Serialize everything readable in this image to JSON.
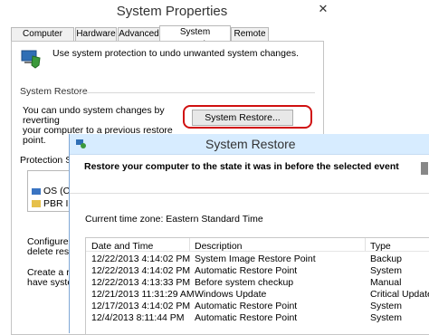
{
  "system_properties": {
    "title": "System Properties",
    "close_glyph": "✕",
    "tabs": [
      "Computer Name",
      "Hardware",
      "Advanced",
      "System Protection",
      "Remote"
    ],
    "active_tab": "System Protection",
    "intro": "Use system protection to undo unwanted system changes.",
    "system_restore_group": "System Restore",
    "system_restore_desc_1": "You can undo system changes by reverting",
    "system_restore_desc_2": "your computer to a previous restore point.",
    "system_restore_button": "System Restore...",
    "protection_settings_label": "Protection Se",
    "drives": [
      "OS (C:",
      "PBR Im"
    ],
    "configure_1": "Configure re",
    "configure_2": "delete restore",
    "create_1": "Create a re",
    "create_2": "have syste"
  },
  "system_restore": {
    "title": "System Restore",
    "header": "Restore your computer to the state it was in before the selected event",
    "timezone": "Current time zone: Eastern Standard Time",
    "columns": [
      "Date and Time",
      "Description",
      "Type"
    ],
    "rows": [
      {
        "date": "12/22/2013 4:14:02 PM",
        "description": "System Image Restore Point",
        "type": "Backup"
      },
      {
        "date": "12/22/2013 4:14:02 PM",
        "description": "Automatic Restore Point",
        "type": "System"
      },
      {
        "date": "12/22/2013 4:13:33 PM",
        "description": "Before system checkup",
        "type": "Manual"
      },
      {
        "date": "12/21/2013 11:31:29 AM",
        "description": "Windows Update",
        "type": "Critical Update"
      },
      {
        "date": "12/17/2013 4:14:02 PM",
        "description": "Automatic Restore Point",
        "type": "System"
      },
      {
        "date": "12/4/2013 8:11:44 PM",
        "description": "Automatic Restore Point",
        "type": "System"
      }
    ]
  },
  "colors": {
    "highlight": "#d01010",
    "titlebar": "#d7ecff"
  }
}
